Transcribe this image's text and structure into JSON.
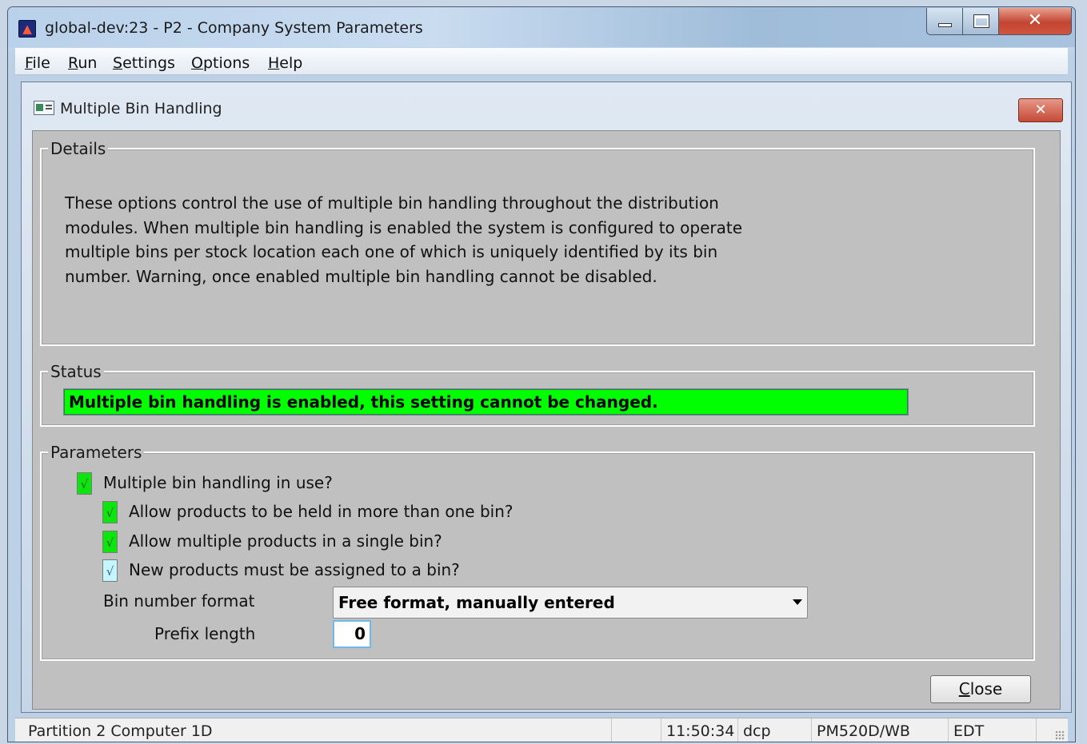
{
  "window": {
    "title": "global-dev:23 - P2 - Company System Parameters"
  },
  "menu": {
    "items": [
      {
        "label": "File",
        "accel": "F",
        "rest": "ile"
      },
      {
        "label": "Run",
        "accel": "R",
        "rest": "un"
      },
      {
        "label": "Settings",
        "accel": "S",
        "rest": "ettings"
      },
      {
        "label": "Options",
        "accel": "O",
        "rest": "ptions"
      },
      {
        "label": "Help",
        "accel": "H",
        "rest": "elp"
      }
    ]
  },
  "dialog": {
    "title": "Multiple Bin Handling",
    "details": {
      "group_title": "Details",
      "text": "These options control the use of multiple bin handling throughout the distribution modules.  When multiple bin handling is enabled the system is configured to operate multiple bins per stock location each one of which is uniquely identified by its bin number.  Warning, once enabled multiple bin handling cannot be disabled."
    },
    "status": {
      "group_title": "Status",
      "message": "Multiple bin handling is enabled, this setting cannot be changed.",
      "color": "#00ff00"
    },
    "parameters": {
      "group_title": "Parameters",
      "checkboxes": [
        {
          "label": "Multiple bin handling in use?",
          "checked": true
        },
        {
          "label": "Allow products to be held in more than one bin?",
          "checked": true
        },
        {
          "label": "Allow multiple products in a single bin?",
          "checked": true
        },
        {
          "label": "New products must be assigned to a bin?",
          "checked": true
        }
      ],
      "check_glyph": "√",
      "bin_number_format_label": "Bin number format",
      "bin_number_format_value": "Free format, manually entered",
      "prefix_length_label": "Prefix length",
      "prefix_length_value": "0"
    },
    "close_button": {
      "label": "Close",
      "accel": "C",
      "rest": "lose"
    }
  },
  "statusbar": {
    "partition": "Partition 2 Computer 1D",
    "time": "11:50:34",
    "user": "dcp",
    "program": "PM520D/WB",
    "mode": "EDT"
  }
}
